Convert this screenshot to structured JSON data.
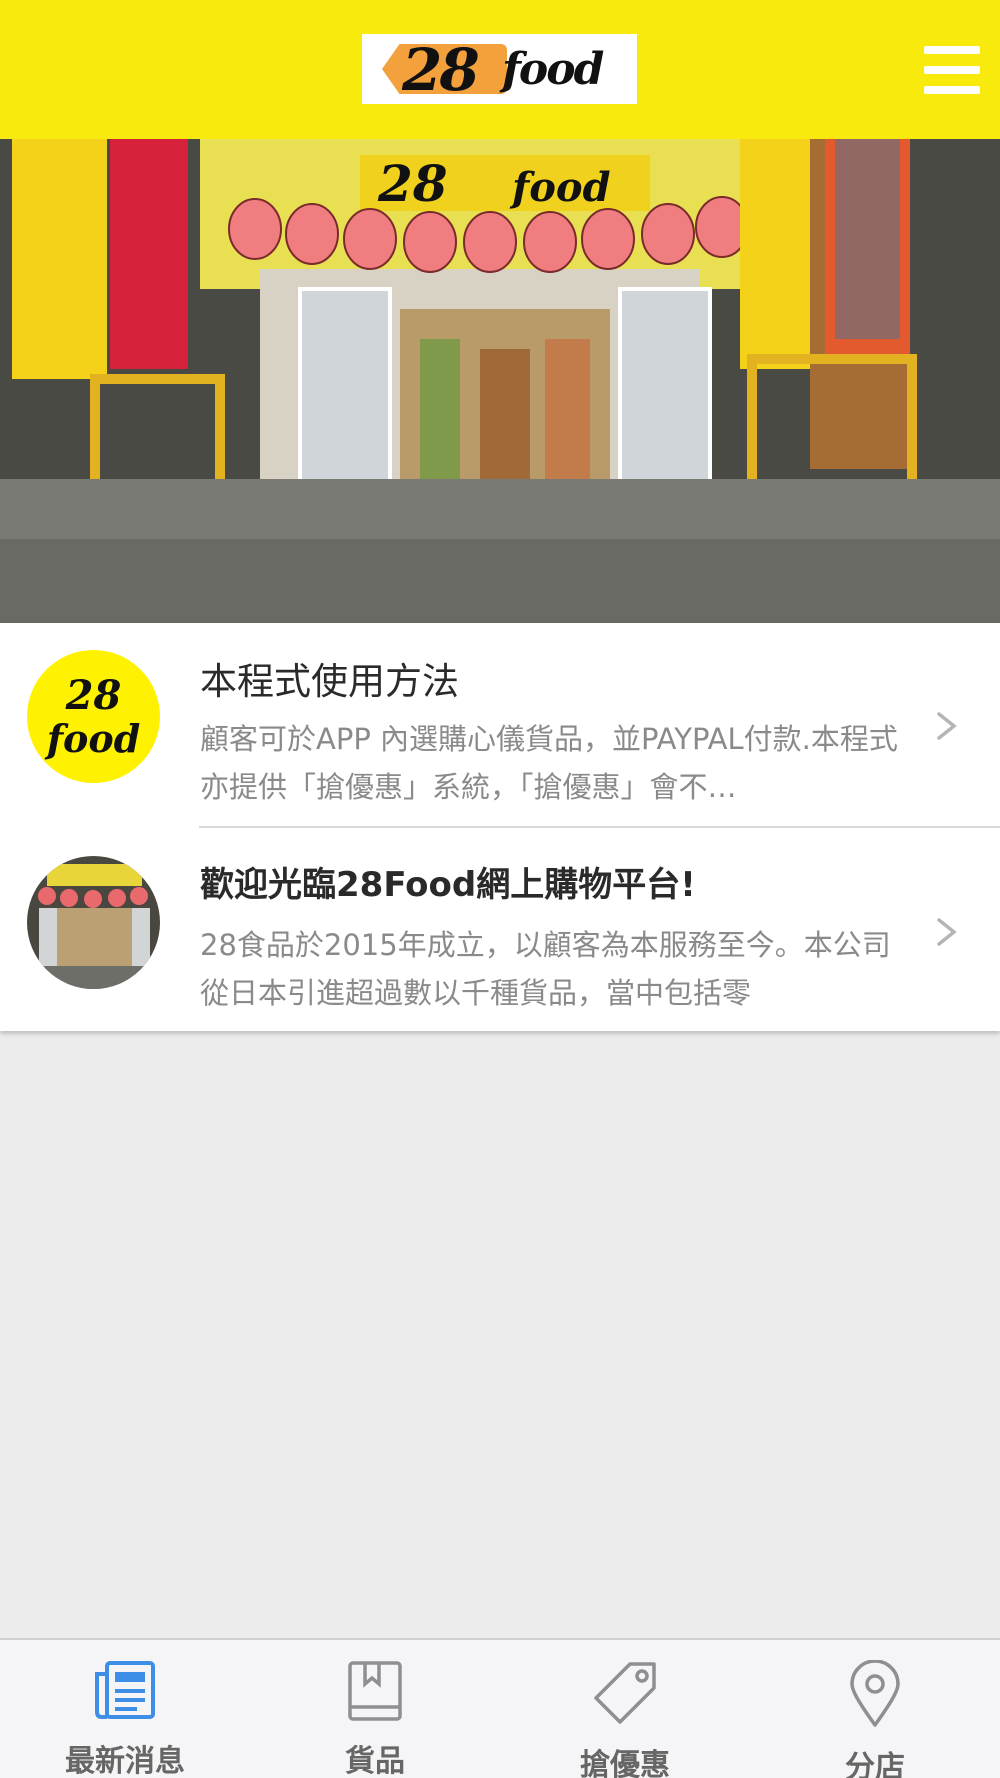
{
  "header": {
    "logo_number": "28",
    "logo_word": "food",
    "menu_icon": "hamburger-menu-icon",
    "background_color": "#f7ea0c"
  },
  "news": [
    {
      "title": "本程式使用方法",
      "description": "顧客可於APP 內選購心儀貨品，並PAYPAL付款.本程式亦提供「搶優惠」系統，「搶優惠」會不…",
      "thumbnail_text_top": "28",
      "thumbnail_text_bottom": "food"
    },
    {
      "title": "歡迎光臨28Food網上購物平台!",
      "description": "28食品於2015年成立，以顧客為本服務至今。本公司從日本引進超過數以千種貨品，當中包括零"
    }
  ],
  "tabbar": {
    "active_color": "#3d8ee6",
    "inactive_color": "#8e8e93",
    "tabs": [
      {
        "label": "最新消息",
        "icon": "newspaper-icon",
        "active": true
      },
      {
        "label": "貨品",
        "icon": "book-icon",
        "active": false
      },
      {
        "label": "搶優惠",
        "icon": "price-tag-icon",
        "active": false
      },
      {
        "label": "分店",
        "icon": "map-pin-icon",
        "active": false
      }
    ]
  }
}
